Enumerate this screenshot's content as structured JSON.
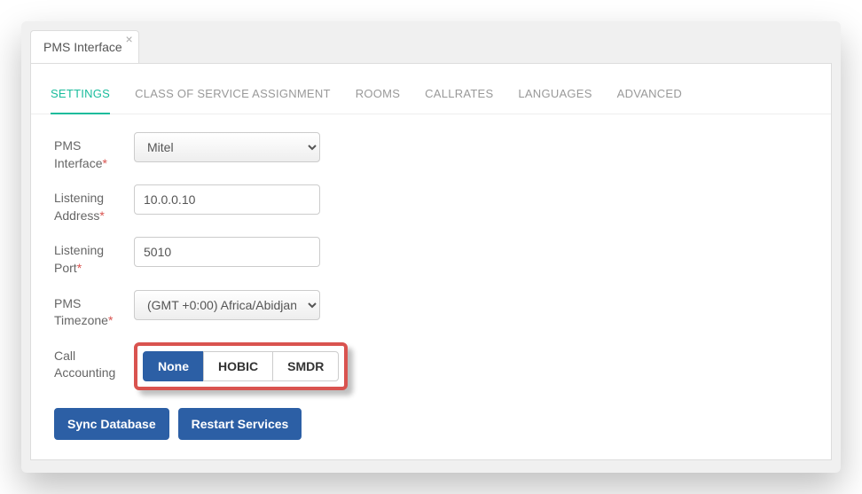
{
  "window": {
    "tab_label": "PMS Interface"
  },
  "tabs": [
    {
      "label": "SETTINGS",
      "active": true
    },
    {
      "label": "CLASS OF SERVICE ASSIGNMENT"
    },
    {
      "label": "ROOMS"
    },
    {
      "label": "CALLRATES"
    },
    {
      "label": "LANGUAGES"
    },
    {
      "label": "ADVANCED"
    }
  ],
  "form": {
    "pms_interface": {
      "label": "PMS Interface",
      "required_mark": "*",
      "value": "Mitel"
    },
    "listening_address": {
      "label": "Listening Address",
      "required_mark": "*",
      "value": "10.0.0.10"
    },
    "listening_port": {
      "label": "Listening Port",
      "required_mark": "*",
      "value": "5010"
    },
    "pms_timezone": {
      "label": "PMS Timezone",
      "required_mark": "*",
      "value": "(GMT +0:00) Africa/Abidjan"
    },
    "call_accounting": {
      "label": "Call Accounting",
      "options": [
        "None",
        "HOBIC",
        "SMDR"
      ],
      "selected": "None"
    }
  },
  "actions": {
    "sync_database": "Sync Database",
    "restart_services": "Restart Services"
  },
  "colors": {
    "accent_teal": "#1abc9c",
    "primary_blue": "#2c5fa5",
    "highlight_red": "#d9534f"
  }
}
